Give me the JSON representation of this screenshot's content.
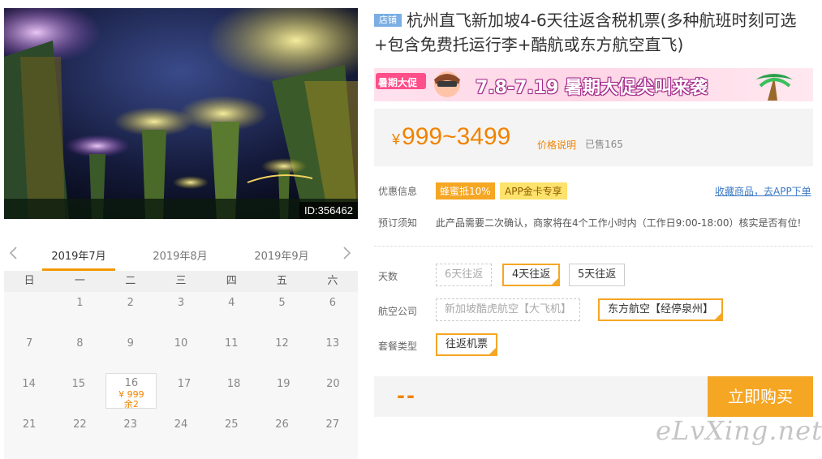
{
  "photo": {
    "id_label": "ID:356462"
  },
  "calendar": {
    "months": [
      "2019年7月",
      "2019年8月",
      "2019年9月"
    ],
    "weekdays": [
      "日",
      "一",
      "二",
      "三",
      "四",
      "五",
      "六"
    ],
    "rows": [
      [
        "",
        "1",
        "2",
        "3",
        "4",
        "5",
        "6"
      ],
      [
        "7",
        "8",
        "9",
        "10",
        "11",
        "12",
        "13"
      ],
      [
        "14",
        "15",
        "16",
        "17",
        "18",
        "19",
        "20"
      ],
      [
        "21",
        "22",
        "23",
        "24",
        "25",
        "26",
        "27"
      ]
    ],
    "selected_price": "¥ 999",
    "selected_remain": "余2"
  },
  "product": {
    "shop_tag": "店铺",
    "title": "杭州直飞新加坡4-6天往返含税机票(多种航班时刻可选+包含免费托运行李+酷航或东方航空直飞)"
  },
  "banner": {
    "left_tag": "暑期大促",
    "text": "7.8-7.19 暑期大促尖叫来袭"
  },
  "price": {
    "currency": "¥",
    "range": "999~3499",
    "explain_link": "价格说明",
    "sold": "已售165"
  },
  "promo": {
    "label": "优惠信息",
    "tag1": "蜂蜜抵10%",
    "tag2": "APP金卡专享",
    "fav_link": "收藏商品，去APP下单"
  },
  "booking": {
    "label": "预订须知",
    "notice": "此产品需要二次确认，商家将在4个工作小时内（工作日9:00-18:00）核实是否有位!"
  },
  "options": {
    "days_label": "天数",
    "days": [
      "6天往返",
      "4天往返",
      "5天往返"
    ],
    "airline_label": "航空公司",
    "airlines": [
      "新加坡酷虎航空【大飞机】",
      "东方航空【经停泉州】"
    ],
    "package_label": "套餐类型",
    "packages": [
      "往返机票"
    ]
  },
  "buy": {
    "price_placeholder": "--",
    "button": "立即购买"
  },
  "watermark": "eLvXing.net",
  "colors": {
    "accent": "#f5a623",
    "price": "#f08300",
    "link": "#3b78c3"
  }
}
